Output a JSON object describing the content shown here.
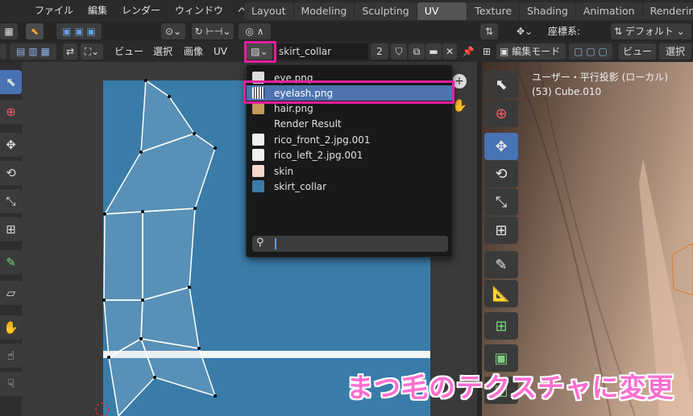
{
  "menubar": {
    "items": [
      "ファイル",
      "編集",
      "レンダー",
      "ウィンドウ",
      "ヘルプ"
    ],
    "workspaces": [
      {
        "label": "Layout",
        "active": false
      },
      {
        "label": "Modeling",
        "active": false
      },
      {
        "label": "Sculpting",
        "active": false
      },
      {
        "label": "UV Editing",
        "active": true
      },
      {
        "label": "Texture Paint",
        "active": false
      },
      {
        "label": "Shading",
        "active": false
      },
      {
        "label": "Animation",
        "active": false
      },
      {
        "label": "Renderin",
        "active": false
      }
    ]
  },
  "uv_editor": {
    "menus": [
      "ビュー",
      "選択",
      "画像",
      "UV"
    ],
    "image_name": "skirt_collar",
    "users_count": "2"
  },
  "image_dropdown": {
    "items": [
      {
        "label": "eye.png",
        "icon": "eye-thumbnail",
        "color": "#dcdcdc",
        "selected": false
      },
      {
        "label": "eyelash.png",
        "icon": "eyelash-thumbnail",
        "color": "#f2f2f2",
        "selected": true
      },
      {
        "label": "hair.png",
        "icon": "hair-thumbnail",
        "color": "#c79a5a",
        "selected": false
      },
      {
        "label": "Render Result",
        "icon": "none",
        "color": "",
        "selected": false
      },
      {
        "label": "rico_front_2.jpg.001",
        "icon": "rico-front-thumbnail",
        "color": "#f0f0f0",
        "selected": false
      },
      {
        "label": "rico_left_2.jpg.001",
        "icon": "rico-left-thumbnail",
        "color": "#f0f0f0",
        "selected": false
      },
      {
        "label": "skin",
        "icon": "skin-thumbnail",
        "color": "#f6d7cc",
        "selected": false
      },
      {
        "label": "skirt_collar",
        "icon": "skirt-collar-thumbnail",
        "color": "#3a7ca8",
        "selected": false
      }
    ],
    "search_placeholder": ""
  },
  "viewport": {
    "coord_label": "座標系:",
    "coord_value": "デフォルト",
    "mode": "編集モード",
    "view_menu": "ビュー",
    "select_menu": "選択",
    "overlay_line1": "ユーザー・平行投影 (ローカル)",
    "overlay_line2": "(53) Cube.010"
  },
  "caption": "まつ毛のテクスチャに変更",
  "colors": {
    "accent": "#4772b3",
    "highlight": "#e91ea0",
    "texture": "#3a7ca8"
  }
}
